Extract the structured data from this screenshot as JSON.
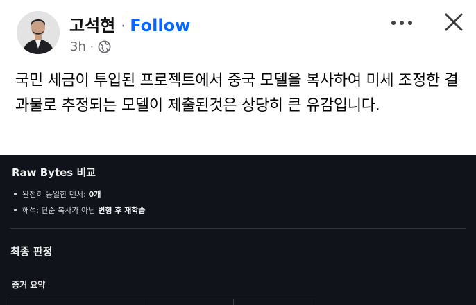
{
  "post": {
    "author": "고석현",
    "separator": "·",
    "follow_label": "Follow",
    "timestamp": "3h",
    "meta_separator": "·",
    "privacy_icon": "globe-icon",
    "more_icon": "more-horizontal-icon",
    "close_icon": "close-icon",
    "text": "국민 세금이 투입된 프로젝트에서 중국 모델을 복사하여 미세 조정한 결과물로 추정되는 모델이 제출된것은 상당히 큰 유감입니다."
  },
  "screenshot": {
    "title": "Raw Bytes 비교",
    "bullets": [
      {
        "text": "완전히 동일한 텐서:",
        "strong": "0개"
      },
      {
        "text": "해석: 단순 복사가 아닌",
        "strong": "변형 후 재학습"
      }
    ],
    "verdict_heading": "최종 판정",
    "summary_heading": "증거 요약"
  },
  "colors": {
    "follow": "#0866ff",
    "dark_panel": "#101319"
  }
}
